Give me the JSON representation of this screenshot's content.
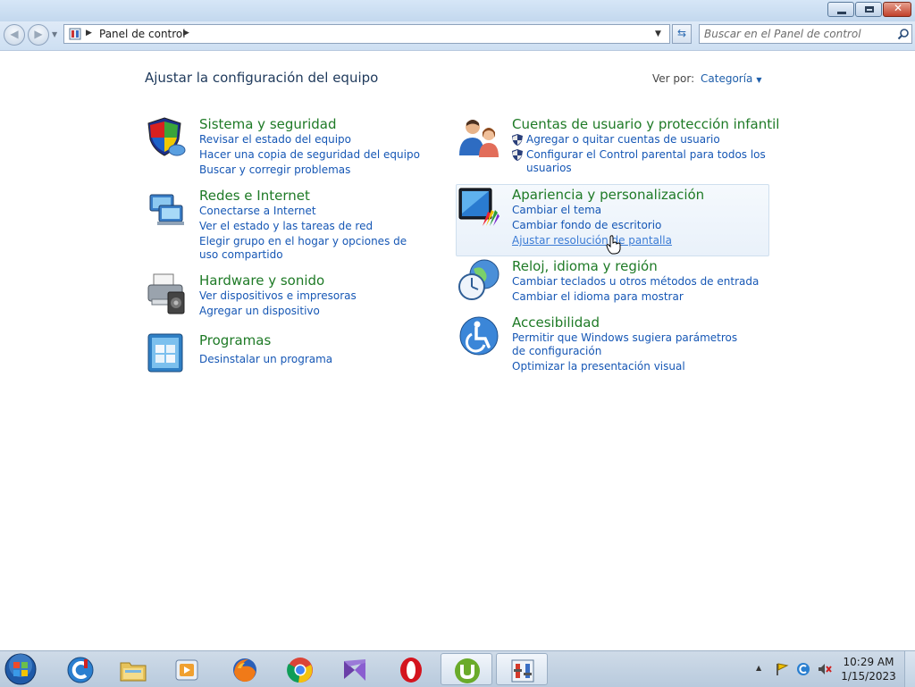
{
  "window": {
    "close_glyph": "✕"
  },
  "address": {
    "path": "Panel de control"
  },
  "search": {
    "placeholder": "Buscar en el Panel de control"
  },
  "page": {
    "title": "Ajustar la configuración del equipo"
  },
  "viewby": {
    "label": "Ver por:",
    "value": "Categoría"
  },
  "categories": [
    {
      "title": "Sistema y seguridad",
      "icon": "shield-icon",
      "links": [
        "Revisar el estado del equipo",
        "Hacer una copia de seguridad del equipo",
        "Buscar y corregir problemas"
      ]
    },
    {
      "title": "Redes e Internet",
      "icon": "network-icon",
      "links": [
        "Conectarse a Internet",
        "Ver el estado y las tareas de red",
        "Elegir grupo en el hogar y opciones de uso compartido"
      ]
    },
    {
      "title": "Hardware y sonido",
      "icon": "printer-icon",
      "links": [
        "Ver dispositivos e impresoras",
        "Agregar un dispositivo"
      ]
    },
    {
      "title": "Programas",
      "icon": "programs-icon",
      "links": [
        "Desinstalar un programa"
      ]
    },
    {
      "title": "Cuentas de usuario y protección infantil",
      "icon": "users-icon",
      "links": [
        "Agregar o quitar cuentas de usuario",
        "Configurar el Control parental para todos los usuarios"
      ]
    },
    {
      "title": "Apariencia y personalización",
      "icon": "monitor-icon",
      "links": [
        "Cambiar el tema",
        "Cambiar fondo de escritorio",
        "Ajustar resolución de pantalla"
      ]
    },
    {
      "title": "Reloj, idioma y región",
      "icon": "globe-clock-icon",
      "links": [
        "Cambiar teclados u otros métodos de entrada",
        "Cambiar el idioma para mostrar"
      ]
    },
    {
      "title": "Accesibilidad",
      "icon": "accessibility-icon",
      "links": [
        "Permitir que Windows sugiera parámetros de configuración",
        "Optimizar la presentación visual"
      ]
    }
  ],
  "taskbar": {
    "apps": [
      "ccleaner-icon",
      "explorer-icon",
      "media-player-icon",
      "firefox-icon",
      "chrome-icon",
      "visual-studio-icon",
      "opera-icon",
      "utorrent-icon",
      "control-panel-icon"
    ],
    "time": "10:29 AM",
    "date": "1/15/2023"
  },
  "colors": {
    "category_title": "#1e7a26",
    "link": "#1657b5",
    "page_title": "#1e395b"
  }
}
